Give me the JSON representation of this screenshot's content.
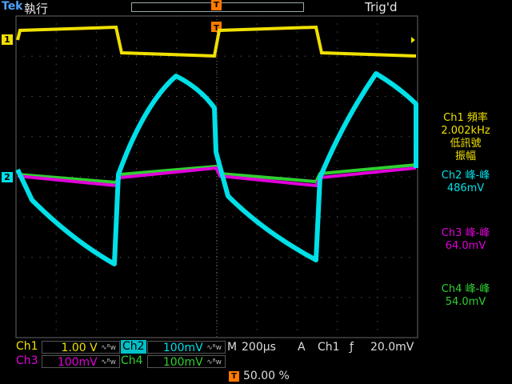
{
  "header": {
    "brand": "Tek",
    "run_state": "執行",
    "trigger_status": "Trig'd",
    "trigger_marker": "T"
  },
  "channels": {
    "ch1_marker": "1",
    "ch2_marker": "2",
    "ch1_color": "#f0e000",
    "ch2_color": "#00e0e8",
    "ch3_color": "#e000d8",
    "ch4_color": "#30d030"
  },
  "measurements": {
    "m1_title": "Ch1 頻率",
    "m1_value": "2.002kHz",
    "m1_note1": "低訊號",
    "m1_note2": "振幅",
    "m2_title": "Ch2 峰-峰",
    "m2_value": "486mV",
    "m3_title": "Ch3 峰-峰",
    "m3_value": "64.0mV",
    "m4_title": "Ch4 峰-峰",
    "m4_value": "54.0mV"
  },
  "status": {
    "ch1_label": "Ch1",
    "ch1_scale": "1.00 V",
    "ch2_label": "Ch2",
    "ch2_scale": "100mV",
    "ch3_label": "Ch3",
    "ch3_scale": "100mV",
    "ch4_label": "Ch4",
    "ch4_scale": "100mV",
    "bw_symbol": "∿ᴮw",
    "timebase_label": "M",
    "timebase": "200µs",
    "trig_mode": "A",
    "trig_source": "Ch1",
    "trig_slope": "ƒ",
    "trig_level": "20.0mV",
    "trig_pos_marker": "T",
    "trig_pos": "50.00 %"
  }
}
